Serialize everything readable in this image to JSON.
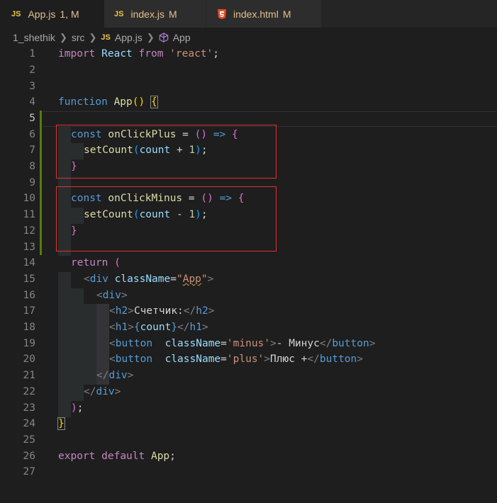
{
  "tabs": [
    {
      "icon": "JS",
      "name": "App.js",
      "status": "1, M",
      "active": true
    },
    {
      "icon": "JS",
      "name": "index.js",
      "status": "M",
      "active": false
    },
    {
      "icon": "html5-icon",
      "name": "index.html",
      "status": "M",
      "active": false
    }
  ],
  "breadcrumb": {
    "folder": "1_shethik",
    "subfolder": "src",
    "file_icon": "JS",
    "file": "App.js",
    "symbol": "App"
  },
  "editor": {
    "line_numbers": [
      "1",
      "2",
      "3",
      "4",
      "5",
      "6",
      "7",
      "8",
      "9",
      "10",
      "11",
      "12",
      "13",
      "14",
      "15",
      "16",
      "17",
      "18",
      "19",
      "20",
      "21",
      "22",
      "23",
      "24",
      "25",
      "26",
      "27"
    ],
    "current_line": "5",
    "lines": {
      "l1": {
        "kw": "import",
        "cls": "React",
        "kw2": "from",
        "str": "'react'",
        "semi": ";"
      },
      "l4": {
        "kw": "function",
        "fn": "App",
        "paren": "()",
        "brace": "{"
      },
      "l6": {
        "kw": "const",
        "fn": "onClickPlus",
        "eq": " = ",
        "paren": "()",
        "arrow": "=>",
        "brace": "{"
      },
      "l7": {
        "fn": "setCount",
        "open": "(",
        "var": "count",
        "op": " + ",
        "num": "1",
        "close": ")",
        "semi": ";"
      },
      "l8": {
        "brace": "}"
      },
      "l10": {
        "kw": "const",
        "fn": "onClickMinus",
        "eq": " = ",
        "paren": "()",
        "arrow": "=>",
        "brace": "{"
      },
      "l11": {
        "fn": "setCount",
        "open": "(",
        "var": "count",
        "op": " - ",
        "num": "1",
        "close": ")",
        "semi": ";"
      },
      "l12": {
        "brace": "}"
      },
      "l14": {
        "kw": "return",
        "paren": "("
      },
      "l15": {
        "lt": "<",
        "tag": "div",
        "attr": "className",
        "eq": "=",
        "q1": "\"",
        "str": "App",
        "q2": "\"",
        "gt": ">"
      },
      "l16": {
        "lt": "<",
        "tag": "div",
        "gt": ">"
      },
      "l17": {
        "lt": "<",
        "tag": "h2",
        "gt": ">",
        "text": "Счетчик:",
        "lt2": "</",
        "tag2": "h2",
        "gt2": ">"
      },
      "l18": {
        "lt": "<",
        "tag": "h1",
        "gt": ">",
        "ob": "{",
        "var": "count",
        "cb": "}",
        "lt2": "</",
        "tag2": "h1",
        "gt2": ">"
      },
      "l19": {
        "lt": "<",
        "tag": "button",
        "sp": "  ",
        "attr": "className",
        "eq": "=",
        "str": "'minus'",
        "gt": ">",
        "text": "- Минус",
        "lt2": "</",
        "tag2": "button",
        "gt2": ">"
      },
      "l20": {
        "lt": "<",
        "tag": "button",
        "sp": "  ",
        "attr": "className",
        "eq": "=",
        "str": "'plus'",
        "gt": ">",
        "text": "Плюс +",
        "lt2": "</",
        "tag2": "button",
        "gt2": ">"
      },
      "l21": {
        "lt": "</",
        "tag": "div",
        "gt": ">"
      },
      "l22": {
        "lt": "</",
        "tag": "div",
        "gt": ">"
      },
      "l23": {
        "paren": ")",
        "semi": ";"
      },
      "l24": {
        "brace": "}"
      },
      "l26": {
        "kw": "export",
        "kw2": "default",
        "cls": "App",
        "semi": ";"
      }
    }
  },
  "colors": {
    "background": "#1e1e1e",
    "git_modified_bar": "#587c0c",
    "highlight_box": "#e0312f",
    "keyword": "#569cd6",
    "function": "#dcdcaa",
    "string": "#ce9178"
  }
}
